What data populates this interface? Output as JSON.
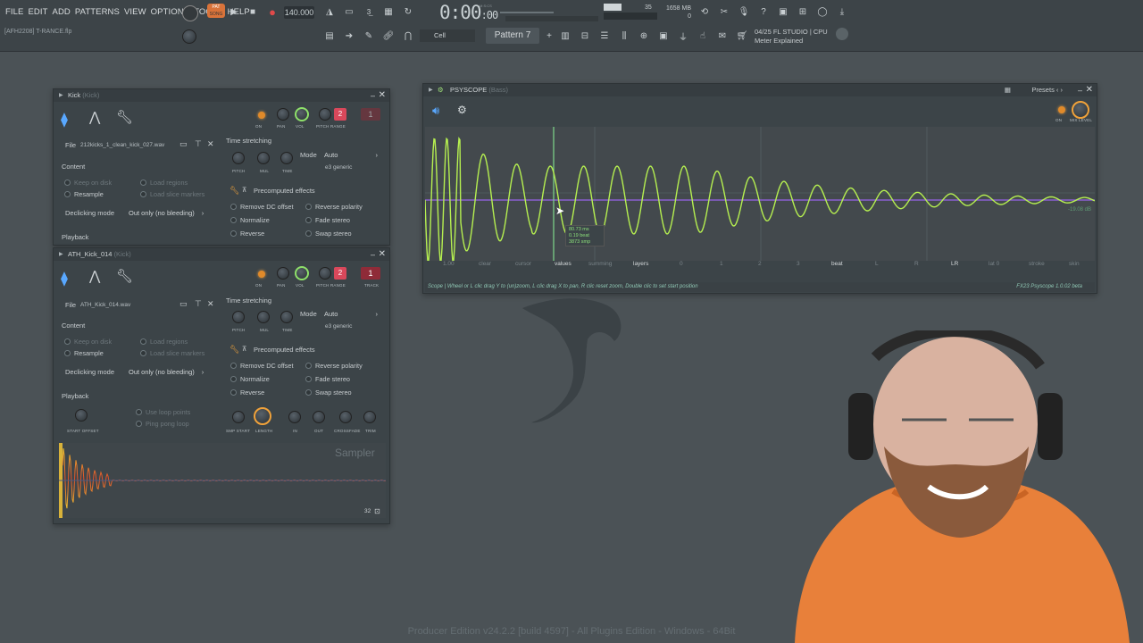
{
  "menu": [
    "FILE",
    "EDIT",
    "ADD",
    "PATTERNS",
    "VIEW",
    "OPTIONS",
    "TOOLS",
    "HELP"
  ],
  "hint_bar": "[AFH2208] T-RANCE.flp",
  "transport": {
    "pat_label": "PAT",
    "song_label": "SONG",
    "tempo": "140.000",
    "time": "0:00",
    "time_small": ":00",
    "mcs": "M:S:CS",
    "snap": "Cell",
    "pattern": "Pattern 7"
  },
  "monitor": {
    "memory": "1658 MB",
    "mem_sub": "0",
    "cpu_val": "35",
    "date": "04/25",
    "studio": "FL STUDIO | CPU",
    "tip": "Meter Explained"
  },
  "sampler1": {
    "title": "Kick",
    "title_sub": "(Kick)",
    "knob_labels": [
      "ON",
      "PAN",
      "VOL",
      "PITCH RANGE"
    ],
    "pitch_range": "2",
    "track": "1",
    "file_label": "File",
    "file_name": "212kicks_1_clean_kick_027.wav",
    "content_label": "Content",
    "keep_on_disk": "Keep on disk",
    "load_regions": "Load regions",
    "resample": "Resample",
    "load_slice": "Load slice markers",
    "declick_label": "Declicking mode",
    "declick_value": "Out only (no bleeding)",
    "playback": "Playback",
    "timestretch": "Time stretching",
    "ts_knobs": [
      "PITCH",
      "MUL",
      "TIME"
    ],
    "mode_label": "Mode",
    "mode_value": "Auto",
    "mode_sub": "e3 generic",
    "precomputed": "Precomputed effects",
    "effects": [
      "Remove DC offset",
      "Reverse polarity",
      "Normalize",
      "Fade stereo",
      "Reverse",
      "Swap stereo"
    ]
  },
  "sampler2": {
    "title": "ATH_Kick_014",
    "title_sub": "(Kick)",
    "knob_labels": [
      "ON",
      "PAN",
      "VOL",
      "PITCH RANGE",
      "TRACK"
    ],
    "pitch_range": "2",
    "track": "1",
    "file_label": "File",
    "file_name": "ATH_Kick_014.wav",
    "content_label": "Content",
    "keep_on_disk": "Keep on disk",
    "load_regions": "Load regions",
    "resample": "Resample",
    "load_slice": "Load slice markers",
    "declick_label": "Declicking mode",
    "declick_value": "Out only (no bleeding)",
    "playback": "Playback",
    "use_loop": "Use loop points",
    "ping_pong": "Ping pong loop",
    "start_offset": "START OFFSET",
    "timestretch": "Time stretching",
    "ts_knobs": [
      "PITCH",
      "MUL",
      "TIME"
    ],
    "mode_label": "Mode",
    "mode_value": "Auto",
    "mode_sub": "e3 generic",
    "precomputed": "Precomputed effects",
    "effects": [
      "Remove DC offset",
      "Reverse polarity",
      "Normalize",
      "Fade stereo",
      "Reverse",
      "Swap stereo"
    ],
    "env_knobs": [
      "SMP START",
      "LENGTH",
      "IN",
      "OUT",
      "CROSSFADE",
      "TRIM"
    ],
    "sampler_label": "Sampler",
    "zoom": "32"
  },
  "psyscope": {
    "title": "PSYSCOPE",
    "title_sub": "(Bass)",
    "presets": "Presets",
    "on": "ON",
    "mix": "MIX LEVEL",
    "controls": [
      "1.00",
      "clear",
      "cursor",
      "values",
      "summing",
      "layers",
      "0",
      "1",
      "2",
      "3",
      "beat",
      "L",
      "R",
      "LR",
      "lat 0",
      "stroke",
      "skin"
    ],
    "readout": [
      "80.73 ms",
      "0.19 beat",
      "3873 smp"
    ],
    "db": "-19.08 dB",
    "footer": "Scope | Wheel or L clic drag Y to (un)zoom, L clic drag X to pan, R clic reset zoom, Double clic to set start position",
    "version": "FX23 Psyscope 1.0.02 beta"
  },
  "watermark": "Producer Edition v24.2.2 [build 4597] - All Plugins Edition - Windows - 64Bit",
  "colors": {
    "accent": "#8ee06a",
    "orange": "#f0a23a",
    "red": "#d9485b",
    "waveform": "#b6f050"
  }
}
